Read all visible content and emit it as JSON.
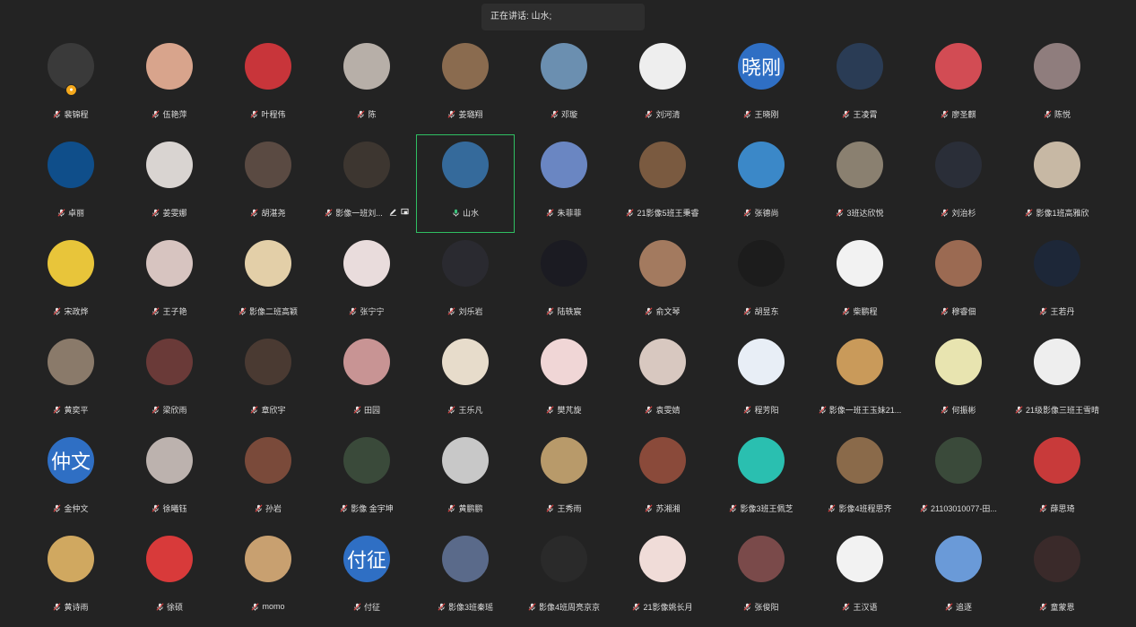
{
  "speaking": {
    "label": "正在讲话: 山水;"
  },
  "colors": {
    "background": "#232323",
    "active_border": "#2fbf62",
    "text_avatar": "#2f6fc4"
  },
  "participants": [
    {
      "name": "裴锦程",
      "avatar": "#3a3a3a",
      "host": true,
      "mic": "muted"
    },
    {
      "name": "伍艳萍",
      "avatar": "#d8a48c",
      "mic": "muted"
    },
    {
      "name": "叶程伟",
      "avatar": "#c8353a",
      "mic": "muted"
    },
    {
      "name": "陈",
      "avatar": "#b7afa8",
      "mic": "muted"
    },
    {
      "name": "姜璐翔",
      "avatar": "#8a6b4f",
      "mic": "muted"
    },
    {
      "name": "邓璇",
      "avatar": "#6b8fb0",
      "mic": "muted"
    },
    {
      "name": "刘河清",
      "avatar": "#eeeeee",
      "mic": "muted"
    },
    {
      "name": "王晓刚",
      "avatar": "#2f6fc4",
      "avatar_text": "晓刚",
      "mic": "muted"
    },
    {
      "name": "王凌霄",
      "avatar": "#2a3c55",
      "mic": "muted"
    },
    {
      "name": "廖圣麒",
      "avatar": "#d24c54",
      "mic": "muted"
    },
    {
      "name": "陈悦",
      "avatar": "#8f7d7d",
      "mic": "muted"
    },
    {
      "name": "卓丽",
      "avatar": "#0f4e8a",
      "mic": "muted"
    },
    {
      "name": "姜雯娜",
      "avatar": "#d9d4d1",
      "mic": "muted"
    },
    {
      "name": "胡湛尧",
      "avatar": "#5a4a42",
      "mic": "muted"
    },
    {
      "name": "影像一班刘...",
      "avatar": "#3d3630",
      "mic": "muted",
      "tools": true
    },
    {
      "name": "山水",
      "avatar": "#356a9b",
      "mic": "active",
      "active": true
    },
    {
      "name": "朱菲菲",
      "avatar": "#6a86c2",
      "mic": "muted"
    },
    {
      "name": "21影像5班王秉睿",
      "avatar": "#7a5a40",
      "mic": "muted"
    },
    {
      "name": "张德尚",
      "avatar": "#3b88c8",
      "mic": "muted"
    },
    {
      "name": "3班达欣悦",
      "avatar": "#8a8070",
      "mic": "muted"
    },
    {
      "name": "刘治杉",
      "avatar": "#2a2e38",
      "mic": "muted"
    },
    {
      "name": "影像1班高雅欣",
      "avatar": "#c7b8a4",
      "mic": "muted"
    },
    {
      "name": "宋政烨",
      "avatar": "#e8c53a",
      "mic": "muted"
    },
    {
      "name": "王子艳",
      "avatar": "#d7c4c0",
      "mic": "muted"
    },
    {
      "name": "影像二班高颖",
      "avatar": "#e3cfa8",
      "mic": "muted"
    },
    {
      "name": "张宁宁",
      "avatar": "#e9dcdc",
      "mic": "muted"
    },
    {
      "name": "刘乐岩",
      "avatar": "#2a2a30",
      "mic": "muted"
    },
    {
      "name": "陆轶宸",
      "avatar": "#1b1b22",
      "mic": "muted"
    },
    {
      "name": "俞文琴",
      "avatar": "#a37a5f",
      "mic": "muted"
    },
    {
      "name": "胡昱东",
      "avatar": "#1c1c1c",
      "mic": "muted"
    },
    {
      "name": "柴鹏程",
      "avatar": "#f2f2f2",
      "mic": "muted"
    },
    {
      "name": "穆睿佃",
      "avatar": "#9b6a52",
      "mic": "muted"
    },
    {
      "name": "王若丹",
      "avatar": "#1d2738",
      "mic": "muted"
    },
    {
      "name": "黄奕平",
      "avatar": "#8a7a6a",
      "mic": "muted"
    },
    {
      "name": "梁欣雨",
      "avatar": "#6a3a38",
      "mic": "muted"
    },
    {
      "name": "章欣宇",
      "avatar": "#4a3a32",
      "mic": "muted"
    },
    {
      "name": "田园",
      "avatar": "#c89494",
      "mic": "muted"
    },
    {
      "name": "王乐凡",
      "avatar": "#e7dccb",
      "mic": "muted"
    },
    {
      "name": "樊芃旋",
      "avatar": "#f0d6d6",
      "mic": "muted"
    },
    {
      "name": "袁雯婧",
      "avatar": "#d8c8c0",
      "mic": "muted"
    },
    {
      "name": "程芳阳",
      "avatar": "#e8eef6",
      "mic": "muted"
    },
    {
      "name": "影像一班王玉妹21...",
      "avatar": "#c99a5a",
      "mic": "muted"
    },
    {
      "name": "何振彬",
      "avatar": "#e8e4b0",
      "mic": "muted"
    },
    {
      "name": "21级影像三班王雪晴",
      "avatar": "#eeeeee",
      "mic": "muted"
    },
    {
      "name": "金仲文",
      "avatar": "#2f6fc4",
      "avatar_text": "仲文",
      "mic": "muted"
    },
    {
      "name": "徐曦钰",
      "avatar": "#bcb2ae",
      "mic": "muted"
    },
    {
      "name": "孙岩",
      "avatar": "#7a4a3a",
      "mic": "muted"
    },
    {
      "name": "影像 金宇坤",
      "avatar": "#3a4a3a",
      "mic": "muted"
    },
    {
      "name": "黄鹏鹏",
      "avatar": "#c8c8c8",
      "mic": "muted"
    },
    {
      "name": "王秀雨",
      "avatar": "#b89a6a",
      "mic": "muted"
    },
    {
      "name": "苏湘湘",
      "avatar": "#8a4a3a",
      "mic": "muted"
    },
    {
      "name": "影像3班王佩芝",
      "avatar": "#2abfb0",
      "mic": "muted"
    },
    {
      "name": "影像4班程思齐",
      "avatar": "#8a6a4a",
      "mic": "muted"
    },
    {
      "name": "21103010077-田...",
      "avatar": "#3a4a3a",
      "mic": "muted"
    },
    {
      "name": "薛思琦",
      "avatar": "#c83a3a",
      "mic": "muted"
    },
    {
      "name": "黄诗雨",
      "avatar": "#d0a860",
      "mic": "muted"
    },
    {
      "name": "徐硕",
      "avatar": "#d83a3a",
      "mic": "muted"
    },
    {
      "name": "momo",
      "avatar": "#c8a070",
      "mic": "muted"
    },
    {
      "name": "付征",
      "avatar": "#2f6fc4",
      "avatar_text": "付征",
      "mic": "muted"
    },
    {
      "name": "影像3班秦瑶",
      "avatar": "#5a6a8a",
      "mic": "muted"
    },
    {
      "name": "影像4班周亮京京",
      "avatar": "#2a2a2a",
      "mic": "muted"
    },
    {
      "name": "21影像姚长月",
      "avatar": "#f0dcd8",
      "mic": "muted"
    },
    {
      "name": "张俊阳",
      "avatar": "#7a4a4a",
      "mic": "muted"
    },
    {
      "name": "王汉语",
      "avatar": "#f2f2f2",
      "mic": "muted"
    },
    {
      "name": "追逐",
      "avatar": "#6a9ad8",
      "mic": "muted"
    },
    {
      "name": "童蒙恩",
      "avatar": "#3a2a2a",
      "mic": "muted"
    }
  ]
}
